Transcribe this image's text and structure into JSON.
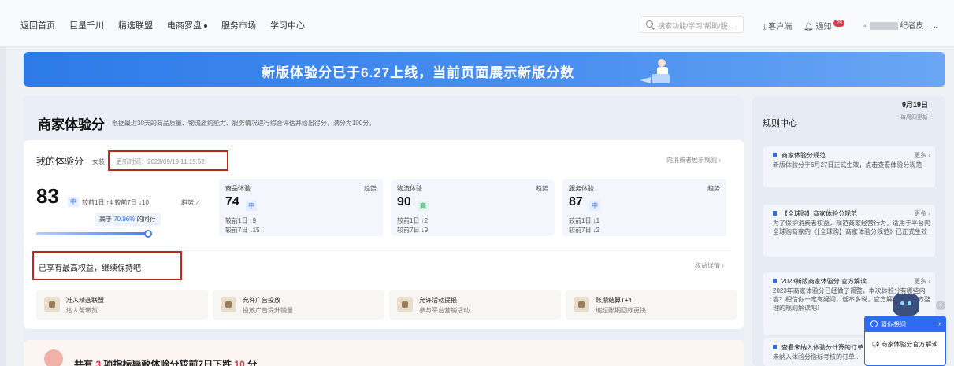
{
  "nav": {
    "items": [
      "返回首页",
      "巨量千川",
      "精选联盟",
      "电商罗盘",
      "服务市场",
      "学习中心"
    ],
    "search_placeholder": "搜索功能/学习/帮助/服...",
    "customer": "客户端",
    "notice": "通知",
    "notice_count": "28",
    "user_suffix": "纪者皮..."
  },
  "banner": {
    "text": "新版体验分已于6.27上线，当前页面展示新版分数"
  },
  "main": {
    "title": "商家体验分",
    "desc": "根据最近30天的商品质量、物流履约能力、服务情况进行综合评估并给出得分，满分为100分。",
    "my_title": "我的体验分",
    "category": "女装",
    "update_time": "更新时间：2023/09/19 11:15:52",
    "show_link": "向消费者展示规则 ›",
    "score": "83",
    "level": "中",
    "compare": "较前1日 ↑4   较前7日 ↓10",
    "trend": "趋势",
    "percentile_prefix": "高于",
    "percentile": "70.96%",
    "percentile_suffix": "的同行",
    "percentile_value": 0.96,
    "subscores": [
      {
        "name": "商品体验",
        "trend": "趋势",
        "score": "74",
        "tag": "中",
        "tag_color": "#3370ff",
        "tag_bg": "#e6efff",
        "d1": "较前1日 ↑9",
        "d7": "较前7日 ↓15"
      },
      {
        "name": "物流体验",
        "trend": "趋势",
        "score": "90",
        "tag": "高",
        "tag_color": "#16a35a",
        "tag_bg": "#e3f6ec",
        "d1": "较前1日 ↑2",
        "d7": "较前7日 ↓9"
      },
      {
        "name": "服务体验",
        "trend": "趋势",
        "score": "87",
        "tag": "中",
        "tag_color": "#3370ff",
        "tag_bg": "#e6efff",
        "d1": "较前1日 ↓1",
        "d7": "较前7日 ↓2"
      }
    ],
    "benefit_status": "已享有最高权益，继续保持吧！",
    "rights_link": "权益详情 ›",
    "benefits": [
      {
        "title": "准入精选联盟",
        "sub": "达人帮带货"
      },
      {
        "title": "允许广告投放",
        "sub": "投放广告提升销量"
      },
      {
        "title": "允许活动提报",
        "sub": "参与平台营销活动"
      },
      {
        "title": "账期结算T+4",
        "sub": "缩短账期回款更快"
      }
    ],
    "bottom": {
      "prefix": "共有",
      "count": "3",
      "middle": "项指标导致体验分较前7日下跌",
      "drop": "10",
      "suffix": "分"
    }
  },
  "rules": {
    "date": "9月19日",
    "date_sub": "每周四更新",
    "title": "规则中心",
    "items": [
      {
        "title": "商家体验分规范",
        "more": "更多 ›",
        "desc": "新版体验分于6月27日正式生效，点击查看体验分规范"
      },
      {
        "title": "【全球购】商家体验分规范",
        "more": "更多 ›",
        "desc": "为了保护消费者权益，规范商家经营行为，适用于平台内全球购商家的《【全球购】商家体验分规范》已正式生效"
      },
      {
        "title": "2023新版商家体验分 官方解读",
        "more": "更多 ›",
        "desc": "2023年商家体验分已经做了调整，本次体验分有哪些内容？相信你一定有疑问，话不多说，官方解读查看官方整理的规则解读吧！"
      },
      {
        "title": "查看未纳入体验分计算的订单",
        "more": "",
        "desc": "未纳入体验分指标考核的订单..."
      }
    ]
  },
  "help": {
    "head": "猜你想问",
    "item": "商家体验分官方解读"
  }
}
